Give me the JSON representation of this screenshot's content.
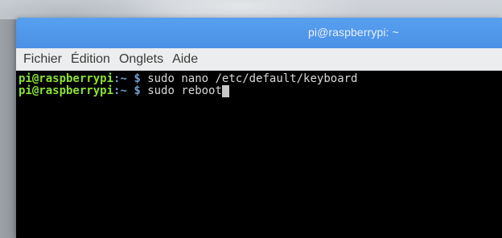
{
  "window": {
    "title": "pi@raspberrypi: ~"
  },
  "menu": {
    "items": [
      "Fichier",
      "Édition",
      "Onglets",
      "Aide"
    ]
  },
  "terminal": {
    "lines": [
      {
        "user_host": "pi@raspberrypi",
        "colon": ":",
        "path": "~",
        "prompt": " $ ",
        "command": "sudo nano /etc/default/keyboard"
      },
      {
        "user_host": "pi@raspberrypi",
        "colon": ":",
        "path": "~",
        "prompt": " $ ",
        "command": "sudo reboot"
      }
    ]
  },
  "colors": {
    "titlebar": "#4b90e6",
    "menubar": "#ecedee",
    "terminal_bg": "#000000",
    "prompt_user": "#8ae234",
    "prompt_path": "#729fcf"
  }
}
